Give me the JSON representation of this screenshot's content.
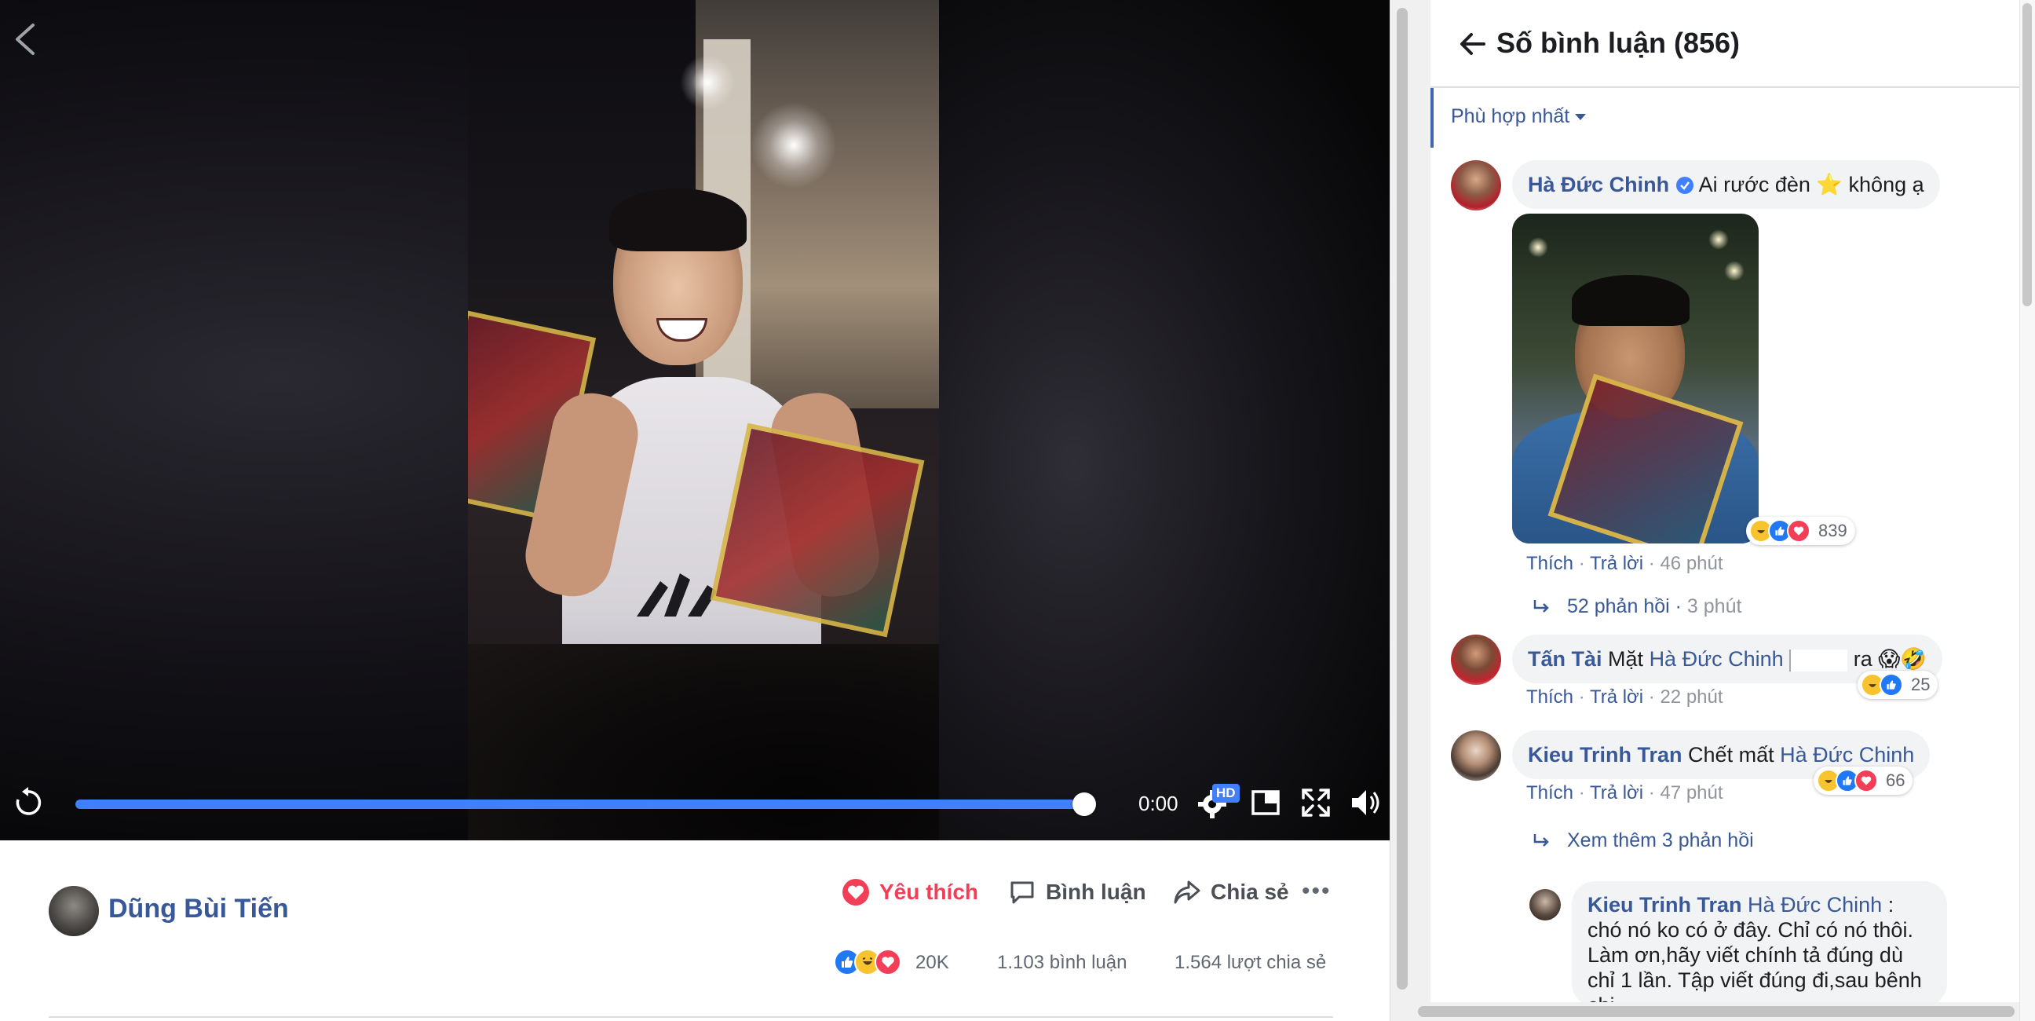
{
  "video": {
    "time": "0:00",
    "hd_label": "HD",
    "progress": 1.0
  },
  "post": {
    "author": "Dũng Bùi Tiến",
    "actions": {
      "like": "Yêu thích",
      "comment": "Bình luận",
      "share": "Chia sẻ",
      "more": "•••"
    },
    "reaction_count": "20K",
    "comments_count": "1.103 bình luận",
    "shares_count": "1.564 lượt chia sẻ"
  },
  "panel": {
    "title": "Số bình luận (856)",
    "sort_label": "Phù hợp nhất"
  },
  "comments": [
    {
      "name": "Hà Đức Chinh",
      "verified": true,
      "text": "Ai rước đèn ⭐ không ạ",
      "reactions": "839",
      "like": "Thích",
      "reply": "Trả lời",
      "time": "46 phút",
      "replies_link": "52 phản hồi",
      "replies_time": "3 phút"
    },
    {
      "name": "Tấn Tài",
      "text_before": "Mặt",
      "mention": "Hà Đức Chinh",
      "text_after": "ra 😱🤣",
      "reactions": "25",
      "like": "Thích",
      "reply": "Trả lời",
      "time": "22 phút"
    },
    {
      "name": "Kieu Trinh Tran",
      "text_before": "Chết mất",
      "mention": "Hà Đức Chinh",
      "reactions": "66",
      "like": "Thích",
      "reply": "Trả lời",
      "time": "47 phút",
      "replies_link": "Xem thêm 3 phản hồi"
    },
    {
      "name": "Kieu Trinh Tran",
      "mention": "Hà Đức Chinh",
      "text": ": chó nó ko có ở đây. Chỉ có nó thôi. Làm ơn,hãy viết chính tả đúng dù chỉ 1 lần. Tập viết đúng đi,sau bênh chị"
    }
  ],
  "colors": {
    "accent": "#4080ff",
    "link": "#385898",
    "like_red": "#f33e58"
  }
}
